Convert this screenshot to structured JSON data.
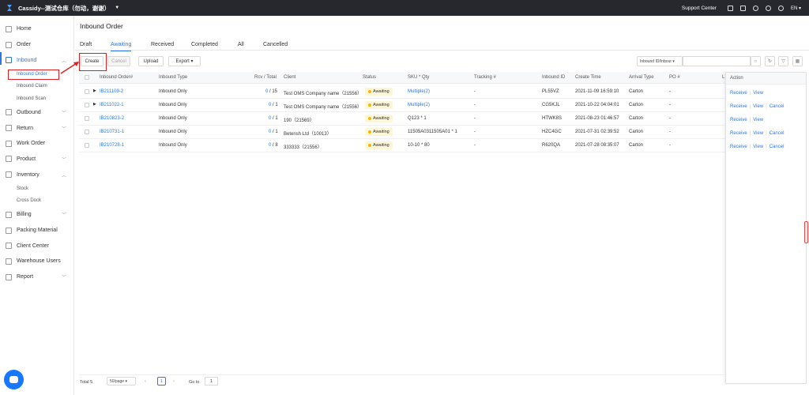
{
  "topbar": {
    "warehouse": "Cassidy--测试仓库（勿动，谢谢）",
    "support": "Support Center",
    "lang": "EN"
  },
  "sidebar": {
    "items": [
      {
        "label": "Home",
        "icon": "home-icon"
      },
      {
        "label": "Order",
        "icon": "cart-icon"
      },
      {
        "label": "Inbound",
        "icon": "inbound-icon"
      },
      {
        "label": "Outbound",
        "icon": "outbound-icon"
      },
      {
        "label": "Return",
        "icon": "return-icon"
      },
      {
        "label": "Work Order",
        "icon": "workorder-icon"
      },
      {
        "label": "Product",
        "icon": "product-icon"
      },
      {
        "label": "Inventory",
        "icon": "inventory-icon"
      },
      {
        "label": "Billing",
        "icon": "billing-icon"
      },
      {
        "label": "Packing Material",
        "icon": "packing-icon"
      },
      {
        "label": "Client Center",
        "icon": "client-icon"
      },
      {
        "label": "Warehouse Users",
        "icon": "users-icon"
      },
      {
        "label": "Report",
        "icon": "report-icon"
      }
    ],
    "inbound_sub": [
      "Inbound Order",
      "Inbound Claim",
      "Inbound Scan"
    ],
    "inventory_sub": [
      "Stock",
      "Cross Dock"
    ]
  },
  "page": {
    "title": "Inbound Order"
  },
  "tabs": [
    "Draft",
    "Awaiting",
    "Received",
    "Completed",
    "All",
    "Cancelled"
  ],
  "toolbar": {
    "create": "Create",
    "cancel": "Cancel",
    "upload": "Upload",
    "export": "Export",
    "filter_select": "Inbound ID/Inbour"
  },
  "table": {
    "headers": [
      "Inbound Order#",
      "Inbound Type",
      "Rcv / Total",
      "Client",
      "Status",
      "SKU * Qty",
      "Tracking #",
      "Inbound ID",
      "Create Time",
      "Arrival Type",
      "PO #",
      "L"
    ],
    "action_header": "Action",
    "rows": [
      {
        "order": "IB211109-2",
        "type": "Inbound Only",
        "rcv": "0",
        "total": "/ 15",
        "client": "Test OMS Company name（21556）",
        "status": "Awaiting",
        "sku": "Multiple(2)",
        "sku_link": true,
        "tracking": "-",
        "inbound_id": "PL55VZ",
        "create_time": "2021-11-09 16:59:10",
        "arrival": "Carton",
        "po": "-",
        "actions": [
          "Receive",
          "View"
        ]
      },
      {
        "order": "IB211022-1",
        "type": "Inbound Only",
        "rcv": "0",
        "total": "/ 1",
        "client": "Test OMS Company name（21556）",
        "status": "Awaiting",
        "sku": "Multiple(2)",
        "sku_link": true,
        "tracking": "-",
        "inbound_id": "CG5KJL",
        "create_time": "2021-10-22 04:04:01",
        "arrival": "Carton",
        "po": "-",
        "actions": [
          "Receive",
          "View",
          "Cancel"
        ]
      },
      {
        "order": "IB210823-2",
        "type": "Inbound Only",
        "rcv": "0",
        "total": "/ 1",
        "client": "190（21569）",
        "status": "Awaiting",
        "sku": "Q123 * 1",
        "sku_link": false,
        "tracking": "-",
        "inbound_id": "HTWK8S",
        "create_time": "2021-08-23 01:46:57",
        "arrival": "Carton",
        "po": "-",
        "actions": [
          "Receive",
          "View"
        ]
      },
      {
        "order": "IB210731-1",
        "type": "Inbound Only",
        "rcv": "0",
        "total": "/ 1",
        "client": "Betensh Ltd（10013）",
        "status": "Awaiting",
        "sku": "11505A0311505A01 * 1",
        "sku_link": false,
        "tracking": "-",
        "inbound_id": "HZC4GC",
        "create_time": "2021-07-31 02:39:52",
        "arrival": "Carton",
        "po": "-",
        "actions": [
          "Receive",
          "View",
          "Cancel"
        ]
      },
      {
        "order": "IB210728-1",
        "type": "Inbound Only",
        "rcv": "0",
        "total": "/ 8",
        "client": "333333（21556）",
        "status": "Awaiting",
        "sku": "10-10 * 80",
        "sku_link": false,
        "tracking": "-",
        "inbound_id": "R620QA",
        "create_time": "2021-07-28 08:35:07",
        "arrival": "Carton",
        "po": "-",
        "actions": [
          "Receive",
          "View",
          "Cancel"
        ]
      }
    ]
  },
  "footer": {
    "total": "Total 5",
    "per_page": "50/page",
    "page": "1",
    "goto_label": "Go to",
    "goto_value": "1"
  },
  "colors": {
    "accent": "#2b78e4",
    "topbar": "#26282d",
    "highlight": "#e02020",
    "awaiting_dot": "#f5b800"
  }
}
